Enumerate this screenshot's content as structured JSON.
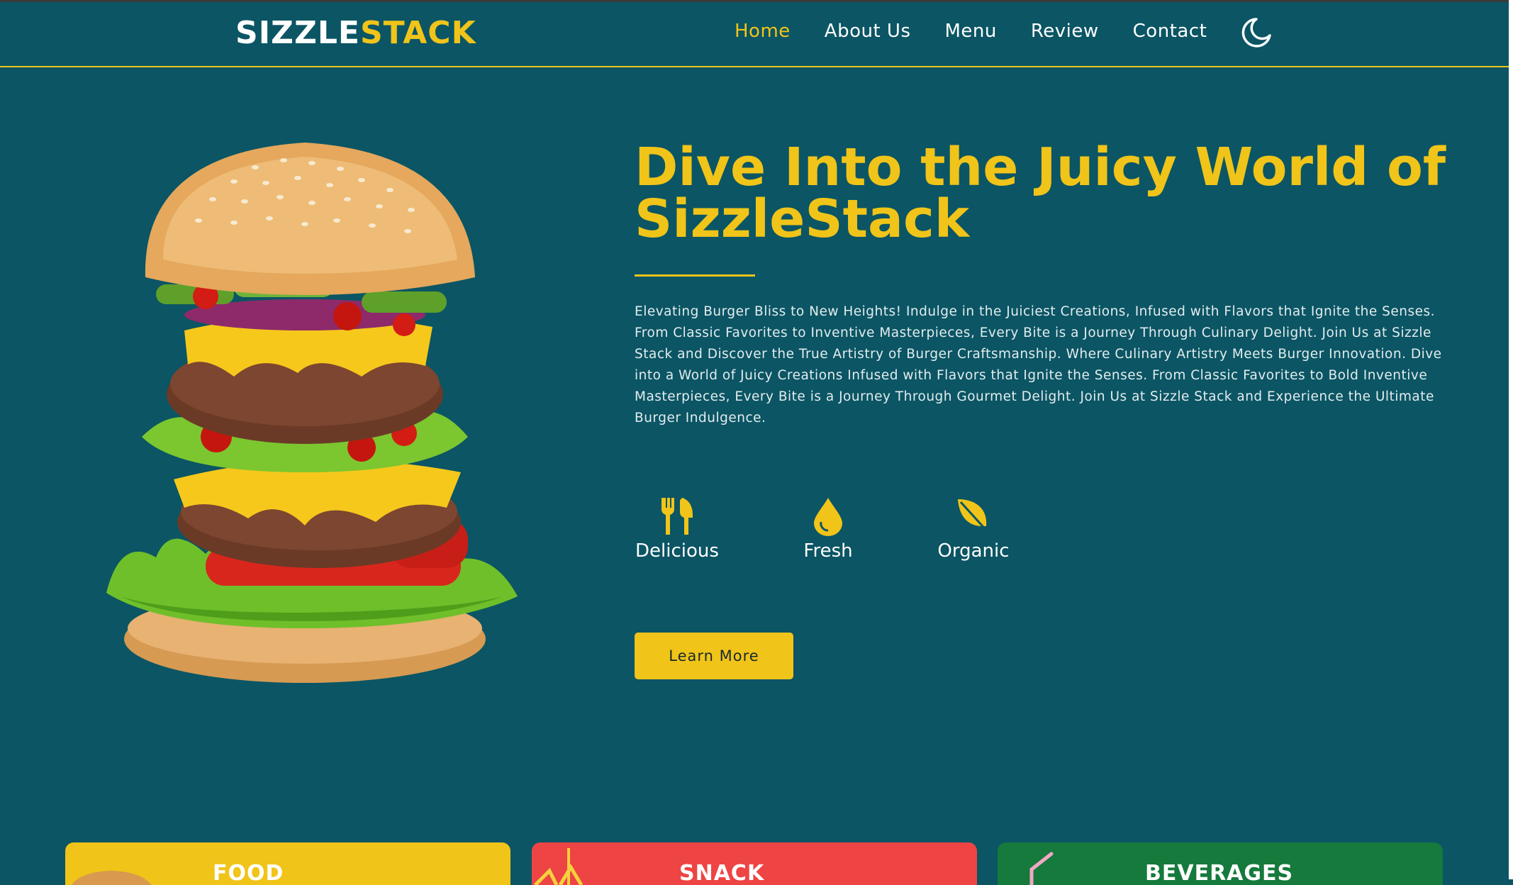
{
  "logo": {
    "part1": "SIZZLE",
    "part2": "STACK"
  },
  "nav": {
    "items": [
      "Home",
      "About Us",
      "Menu",
      "Review",
      "Contact"
    ],
    "active": "Home",
    "theme_toggle_icon": "moon-icon"
  },
  "hero": {
    "title": "Dive Into the Juicy World of SizzleStack",
    "description": "Elevating Burger Bliss to New Heights! Indulge in the Juiciest Creations, Infused with Flavors that Ignite the Senses. From Classic Favorites to Inventive Masterpieces, Every Bite is a Journey Through Culinary Delight. Join Us at Sizzle Stack and Discover the True Artistry of Burger Craftsmanship. Where Culinary Artistry Meets Burger Innovation. Dive into a World of Juicy Creations Infused with Flavors that Ignite the Senses. From Classic Favorites to Bold Inventive Masterpieces, Every Bite is a Journey Through Gourmet Delight. Join Us at Sizzle Stack and Experience the Ultimate Burger Indulgence.",
    "features": [
      {
        "icon": "fork-knife-icon",
        "label": "Delicious"
      },
      {
        "icon": "drop-icon",
        "label": "Fresh"
      },
      {
        "icon": "leaf-icon",
        "label": "Organic"
      }
    ],
    "button_label": "Learn More"
  },
  "categories": [
    {
      "title": "FOOD"
    },
    {
      "title": "SNACK"
    },
    {
      "title": "BEVERAGES"
    }
  ],
  "colors": {
    "background": "#0b5564",
    "accent": "#f0c419",
    "snack": "#ee4444",
    "beverages": "#157a3c"
  }
}
